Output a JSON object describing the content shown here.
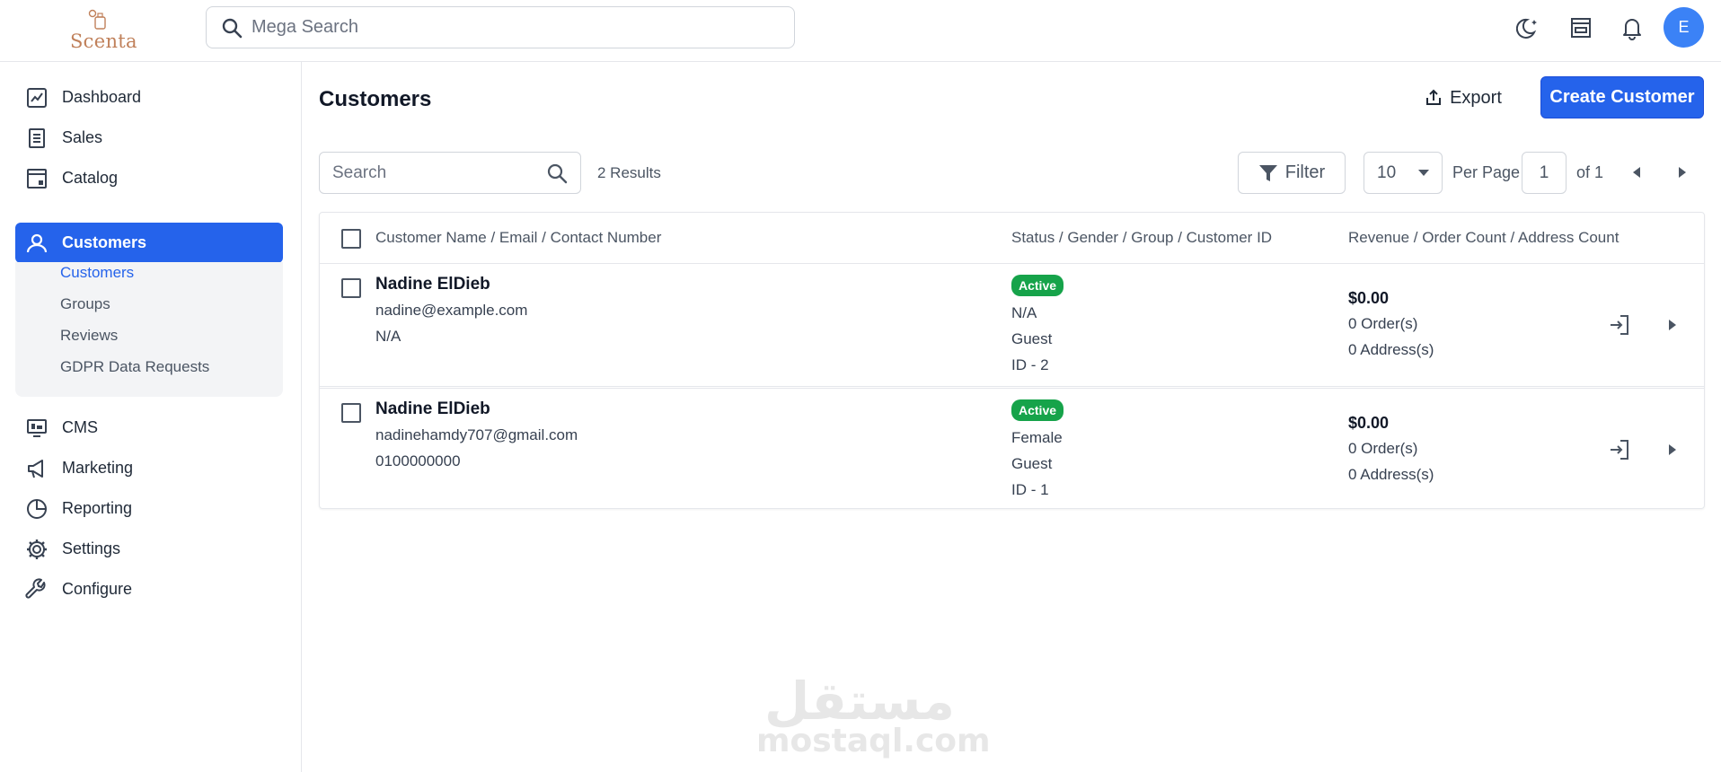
{
  "header": {
    "logo_text": "Scenta",
    "search_placeholder": "Mega Search",
    "avatar_initial": "E",
    "icons": [
      "moon-icon",
      "store-icon",
      "bell-icon"
    ]
  },
  "sidebar": {
    "items": [
      {
        "label": "Dashboard",
        "icon": "dashboard-icon"
      },
      {
        "label": "Sales",
        "icon": "receipt-icon"
      },
      {
        "label": "Catalog",
        "icon": "catalog-icon"
      },
      {
        "label": "Customers",
        "icon": "user-icon"
      },
      {
        "label": "CMS",
        "icon": "monitor-icon"
      },
      {
        "label": "Marketing",
        "icon": "megaphone-icon"
      },
      {
        "label": "Reporting",
        "icon": "pie-chart-icon"
      },
      {
        "label": "Settings",
        "icon": "gear-icon"
      },
      {
        "label": "Configure",
        "icon": "wrench-icon"
      }
    ],
    "active": "Customers",
    "sub_items": [
      "Customers",
      "Groups",
      "Reviews",
      "GDPR Data Requests"
    ],
    "active_sub": "Customers"
  },
  "main": {
    "title": "Customers",
    "export_label": "Export",
    "create_label": "Create Customer",
    "search_placeholder": "Search",
    "results_text": "2 Results",
    "filter_label": "Filter",
    "per_page_value": "10",
    "per_page_label": "Per Page",
    "page_value": "1",
    "page_of": "of 1"
  },
  "table": {
    "columns": [
      "Customer Name / Email / Contact Number",
      "Status / Gender / Group / Customer ID",
      "Revenue / Order Count / Address Count"
    ],
    "rows": [
      {
        "name": "Nadine ElDieb",
        "email": "nadine@example.com",
        "phone": "N/A",
        "status": "Active",
        "gender": "N/A",
        "group": "Guest",
        "id": "ID - 2",
        "revenue": "$0.00",
        "orders": "0 Order(s)",
        "addresses": "0 Address(s)"
      },
      {
        "name": "Nadine ElDieb",
        "email": "nadinehamdy707@gmail.com",
        "phone": "0100000000",
        "status": "Active",
        "gender": "Female",
        "group": "Guest",
        "id": "ID - 1",
        "revenue": "$0.00",
        "orders": "0 Order(s)",
        "addresses": "0 Address(s)"
      }
    ]
  },
  "watermark": {
    "arabic": "مستقل",
    "latin": "mostaql.com"
  },
  "colors": {
    "accent": "#2563eb",
    "status_active": "#16a34a",
    "logo": "#c0805a",
    "avatar": "#3b82f6"
  }
}
